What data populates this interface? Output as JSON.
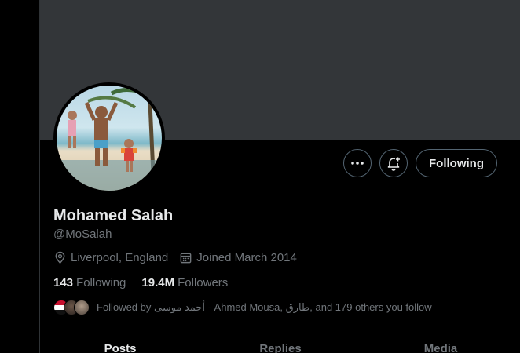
{
  "profile": {
    "name": "Mohamed Salah",
    "handle": "@MoSalah",
    "location": "Liverpool, England",
    "joined": "Joined March 2014"
  },
  "actions": {
    "follow_label": "Following"
  },
  "stats": {
    "following_count": "143",
    "following_label": "Following",
    "followers_count": "19.4M",
    "followers_label": "Followers"
  },
  "followed_by": {
    "text": "Followed by أحمد موسى - Ahmed Mousa, طارق, and 179 others you follow"
  },
  "tabs": [
    {
      "label": "Posts"
    },
    {
      "label": "Replies"
    },
    {
      "label": "Media"
    }
  ],
  "icons": {
    "more": "more-icon",
    "notify": "bell-plus-icon",
    "location": "location-pin-icon",
    "calendar": "calendar-icon"
  },
  "colors": {
    "background": "#000000",
    "banner": "#333639",
    "text_primary": "#e7e9ea",
    "text_secondary": "#71767b",
    "border": "#536471"
  }
}
